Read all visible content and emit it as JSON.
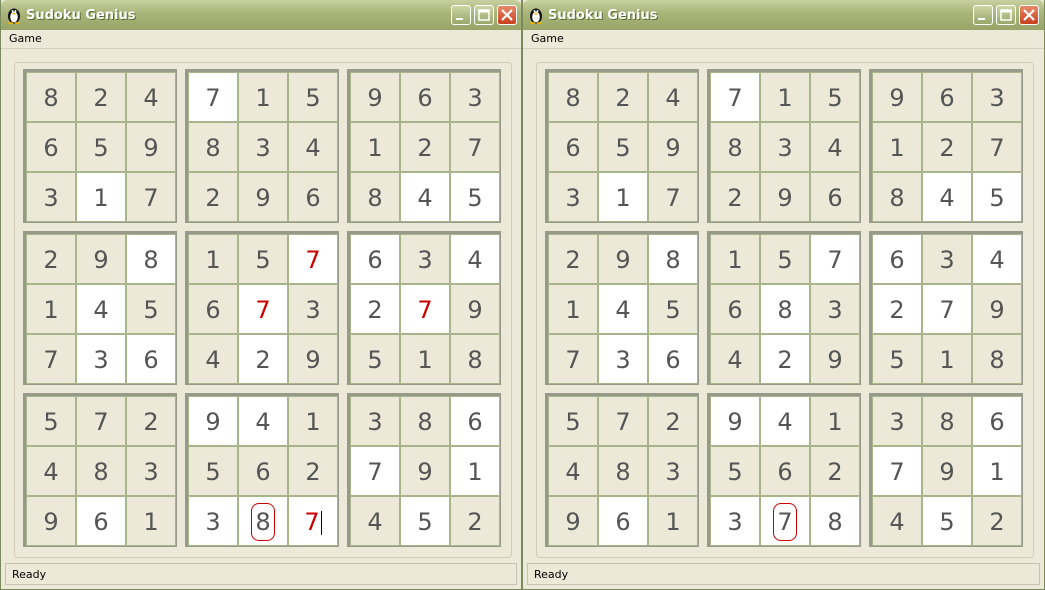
{
  "windows": [
    {
      "title": "Sudoku Genius",
      "menu": [
        "Game"
      ],
      "status": "Ready",
      "boxes": [
        [
          [
            "8",
            "e"
          ],
          [
            "2",
            "e"
          ],
          [
            "4",
            "e"
          ],
          [
            "6",
            "e"
          ],
          [
            "5",
            "e"
          ],
          [
            "9",
            "e"
          ],
          [
            "3",
            "e"
          ],
          [
            "1",
            "w"
          ],
          [
            "7",
            "e"
          ]
        ],
        [
          [
            "7",
            "w"
          ],
          [
            "1",
            "e"
          ],
          [
            "5",
            "e"
          ],
          [
            "8",
            "e"
          ],
          [
            "3",
            "e"
          ],
          [
            "4",
            "e"
          ],
          [
            "2",
            "e"
          ],
          [
            "9",
            "e"
          ],
          [
            "6",
            "e"
          ]
        ],
        [
          [
            "9",
            "e"
          ],
          [
            "6",
            "e"
          ],
          [
            "3",
            "e"
          ],
          [
            "1",
            "e"
          ],
          [
            "2",
            "e"
          ],
          [
            "7",
            "e"
          ],
          [
            "8",
            "e"
          ],
          [
            "4",
            "w"
          ],
          [
            "5",
            "w"
          ]
        ],
        [
          [
            "2",
            "e"
          ],
          [
            "9",
            "e"
          ],
          [
            "8",
            "w"
          ],
          [
            "1",
            "e"
          ],
          [
            "4",
            "w"
          ],
          [
            "5",
            "e"
          ],
          [
            "7",
            "e"
          ],
          [
            "3",
            "w"
          ],
          [
            "6",
            "w"
          ]
        ],
        [
          [
            "1",
            "e"
          ],
          [
            "5",
            "e"
          ],
          [
            "7",
            "w",
            "red"
          ],
          [
            "6",
            "e"
          ],
          [
            "7",
            "w",
            "red"
          ],
          [
            "3",
            "e"
          ],
          [
            "4",
            "e"
          ],
          [
            "2",
            "w"
          ],
          [
            "9",
            "e"
          ]
        ],
        [
          [
            "6",
            "w"
          ],
          [
            "3",
            "e"
          ],
          [
            "4",
            "w"
          ],
          [
            "2",
            "w"
          ],
          [
            "7",
            "w",
            "red"
          ],
          [
            "9",
            "e"
          ],
          [
            "5",
            "e"
          ],
          [
            "1",
            "e"
          ],
          [
            "8",
            "e"
          ]
        ],
        [
          [
            "5",
            "e"
          ],
          [
            "7",
            "e"
          ],
          [
            "2",
            "e"
          ],
          [
            "4",
            "e"
          ],
          [
            "8",
            "e"
          ],
          [
            "3",
            "e"
          ],
          [
            "9",
            "e"
          ],
          [
            "6",
            "w"
          ],
          [
            "1",
            "e"
          ]
        ],
        [
          [
            "9",
            "w"
          ],
          [
            "4",
            "w"
          ],
          [
            "1",
            "e"
          ],
          [
            "5",
            "e"
          ],
          [
            "6",
            "e"
          ],
          [
            "2",
            "e"
          ],
          [
            "3",
            "w"
          ],
          [
            "8",
            "w",
            "circled"
          ],
          [
            "7",
            "w",
            "red",
            "cursor"
          ]
        ],
        [
          [
            "3",
            "e"
          ],
          [
            "8",
            "e"
          ],
          [
            "6",
            "w"
          ],
          [
            "7",
            "w"
          ],
          [
            "9",
            "e"
          ],
          [
            "1",
            "w"
          ],
          [
            "4",
            "e"
          ],
          [
            "5",
            "w"
          ],
          [
            "2",
            "e"
          ]
        ]
      ]
    },
    {
      "title": "Sudoku Genius",
      "menu": [
        "Game"
      ],
      "status": "Ready",
      "boxes": [
        [
          [
            "8",
            "e"
          ],
          [
            "2",
            "e"
          ],
          [
            "4",
            "e"
          ],
          [
            "6",
            "e"
          ],
          [
            "5",
            "e"
          ],
          [
            "9",
            "e"
          ],
          [
            "3",
            "e"
          ],
          [
            "1",
            "w"
          ],
          [
            "7",
            "e"
          ]
        ],
        [
          [
            "7",
            "w"
          ],
          [
            "1",
            "e"
          ],
          [
            "5",
            "e"
          ],
          [
            "8",
            "e"
          ],
          [
            "3",
            "e"
          ],
          [
            "4",
            "e"
          ],
          [
            "2",
            "e"
          ],
          [
            "9",
            "e"
          ],
          [
            "6",
            "e"
          ]
        ],
        [
          [
            "9",
            "e"
          ],
          [
            "6",
            "e"
          ],
          [
            "3",
            "e"
          ],
          [
            "1",
            "e"
          ],
          [
            "2",
            "e"
          ],
          [
            "7",
            "e"
          ],
          [
            "8",
            "e"
          ],
          [
            "4",
            "w"
          ],
          [
            "5",
            "w"
          ]
        ],
        [
          [
            "2",
            "e"
          ],
          [
            "9",
            "e"
          ],
          [
            "8",
            "w"
          ],
          [
            "1",
            "e"
          ],
          [
            "4",
            "w"
          ],
          [
            "5",
            "e"
          ],
          [
            "7",
            "e"
          ],
          [
            "3",
            "w"
          ],
          [
            "6",
            "w"
          ]
        ],
        [
          [
            "1",
            "e"
          ],
          [
            "5",
            "e"
          ],
          [
            "7",
            "w"
          ],
          [
            "6",
            "e"
          ],
          [
            "8",
            "w"
          ],
          [
            "3",
            "e"
          ],
          [
            "4",
            "e"
          ],
          [
            "2",
            "w"
          ],
          [
            "9",
            "e"
          ]
        ],
        [
          [
            "6",
            "w"
          ],
          [
            "3",
            "e"
          ],
          [
            "4",
            "w"
          ],
          [
            "2",
            "w"
          ],
          [
            "7",
            "w"
          ],
          [
            "9",
            "e"
          ],
          [
            "5",
            "e"
          ],
          [
            "1",
            "e"
          ],
          [
            "8",
            "e"
          ]
        ],
        [
          [
            "5",
            "e"
          ],
          [
            "7",
            "e"
          ],
          [
            "2",
            "e"
          ],
          [
            "4",
            "e"
          ],
          [
            "8",
            "e"
          ],
          [
            "3",
            "e"
          ],
          [
            "9",
            "e"
          ],
          [
            "6",
            "w"
          ],
          [
            "1",
            "e"
          ]
        ],
        [
          [
            "9",
            "w"
          ],
          [
            "4",
            "w"
          ],
          [
            "1",
            "e"
          ],
          [
            "5",
            "e"
          ],
          [
            "6",
            "e"
          ],
          [
            "2",
            "e"
          ],
          [
            "3",
            "w"
          ],
          [
            "7",
            "w",
            "circled"
          ],
          [
            "8",
            "w"
          ]
        ],
        [
          [
            "3",
            "e"
          ],
          [
            "8",
            "e"
          ],
          [
            "6",
            "w"
          ],
          [
            "7",
            "w"
          ],
          [
            "9",
            "e"
          ],
          [
            "1",
            "w"
          ],
          [
            "4",
            "e"
          ],
          [
            "5",
            "w"
          ],
          [
            "2",
            "e"
          ]
        ]
      ]
    }
  ],
  "colors": {
    "accent_red": "#cc0000",
    "cell_bg": "#ece9d8",
    "given_white": "#ffffff"
  }
}
